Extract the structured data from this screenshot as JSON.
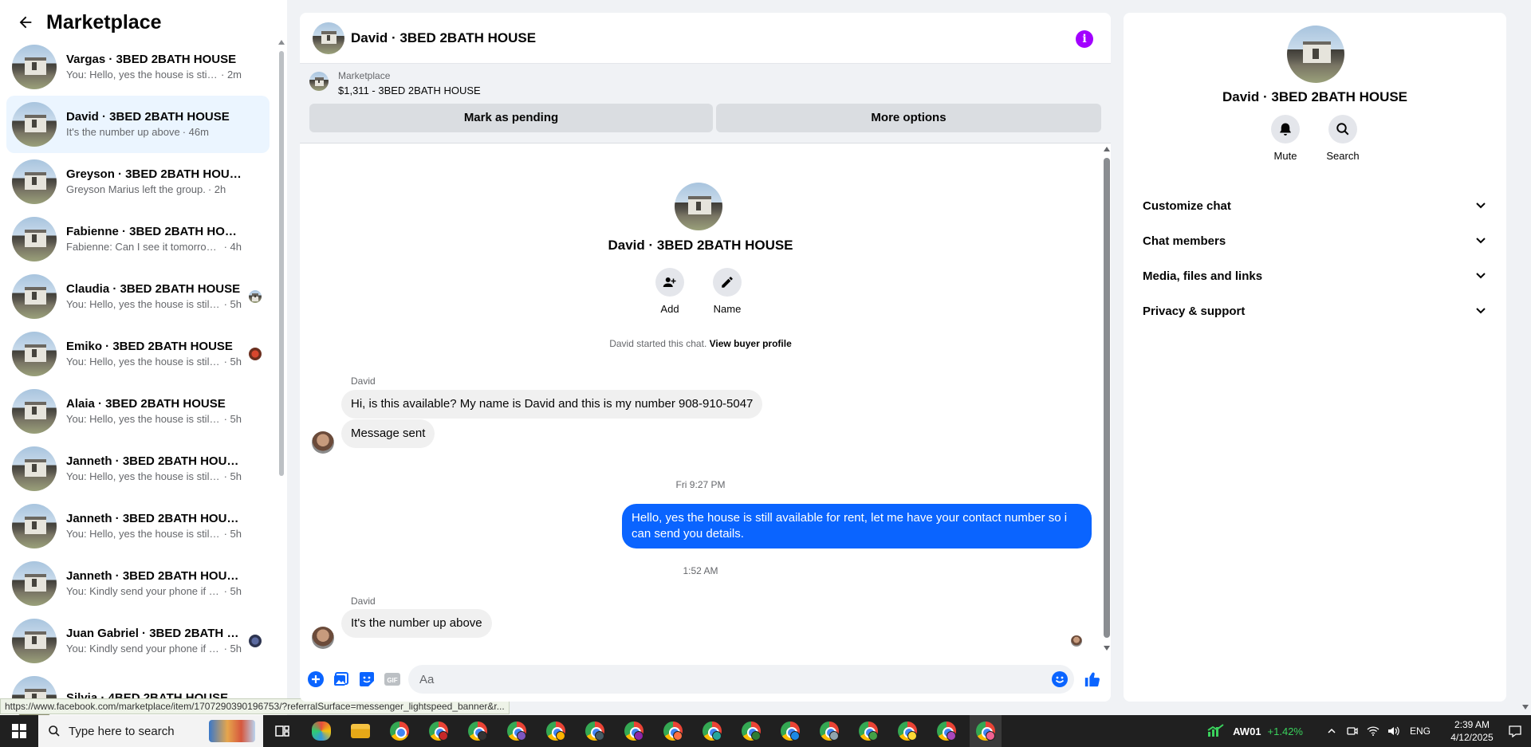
{
  "sidebar": {
    "title": "Marketplace",
    "conversations": [
      {
        "name": "Vargas · 3BED 2BATH HOUSE",
        "preview": "You: Hello, yes the house is still av...",
        "time": "· 2m",
        "read_avatar": false
      },
      {
        "name": "David · 3BED 2BATH HOUSE",
        "preview": "It's the number up above",
        "time": "· 46m",
        "read_avatar": false
      },
      {
        "name": "Greyson · 3BED 2BATH HOUSE",
        "preview": "Greyson Marius left the group.",
        "time": "· 2h",
        "read_avatar": false
      },
      {
        "name": "Fabienne · 3BED 2BATH HOUSE",
        "preview": "Fabienne: Can I see it tomorrow Go...",
        "time": "· 4h",
        "read_avatar": false
      },
      {
        "name": "Claudia · 3BED 2BATH HOUSE",
        "preview": "You: Hello, yes the house is still a...",
        "time": "· 5h",
        "read_avatar": true
      },
      {
        "name": "Emiko · 3BED 2BATH HOUSE",
        "preview": "You: Hello, yes the house is still a...",
        "time": "· 5h",
        "read_avatar": true
      },
      {
        "name": "Alaia · 3BED 2BATH HOUSE",
        "preview": "You: Hello, yes the house is still avai...",
        "time": "· 5h",
        "read_avatar": false
      },
      {
        "name": "Janneth · 3BED 2BATH HOUSE",
        "preview": "You: Hello, yes the house is still avai...",
        "time": "· 5h",
        "read_avatar": false
      },
      {
        "name": "Janneth · 3BED 2BATH HOUSE",
        "preview": "You: Hello, yes the house is still avai...",
        "time": "· 5h",
        "read_avatar": false
      },
      {
        "name": "Janneth · 3BED 2BATH HOUSE",
        "preview": "You: Kindly send your phone if you ...",
        "time": "· 5h",
        "read_avatar": false
      },
      {
        "name": "Juan Gabriel · 3BED 2BATH H...",
        "preview": "You: Kindly send your phone if y...",
        "time": "· 5h",
        "read_avatar": true
      },
      {
        "name": "Silvia · 4BED 2BATH HOUSE",
        "preview": "",
        "time": "",
        "read_avatar": false
      }
    ],
    "active_index": 1
  },
  "status_url": "https://www.facebook.com/marketplace/item/1707290390196753/?referralSurface=messenger_lightspeed_banner&r...",
  "chat": {
    "title": "David · 3BED 2BATH HOUSE",
    "listing": {
      "source": "Marketplace",
      "price_title": "$1,311 - 3BED 2BATH HOUSE"
    },
    "buttons": {
      "pending": "Mark as pending",
      "more": "More options"
    },
    "intro": {
      "name": "David · 3BED 2BATH HOUSE",
      "add_label": "Add",
      "name_label": "Name",
      "started_note": "David started this chat.",
      "buyer_link": "View buyer profile"
    },
    "messages": {
      "sender1": "David",
      "msg1": "Hi, is this available? My name is David and this is my number 908-910-5047",
      "msg2": "Message sent",
      "time1": "Fri 9:27 PM",
      "msg3": "Hello, yes the house is still available for rent, let me have your contact number so i can send you details.",
      "time2": "1:52 AM",
      "sender2": "David",
      "msg4": "It's the number up above"
    },
    "composer": {
      "placeholder": "Aa"
    }
  },
  "info_panel": {
    "name": "David · 3BED 2BATH HOUSE",
    "mute_label": "Mute",
    "search_label": "Search",
    "sections": [
      "Customize chat",
      "Chat members",
      "Media, files and links",
      "Privacy & support"
    ]
  },
  "taskbar": {
    "search_placeholder": "Type here to search",
    "stock_symbol": "AW01",
    "stock_change": "+1.42%",
    "language": "ENG",
    "time": "2:39 AM",
    "date": "4/12/2025"
  },
  "colors": {
    "accent": "#0a64ff",
    "info_icon": "#a200ff",
    "active_row": "#ebf5ff"
  }
}
